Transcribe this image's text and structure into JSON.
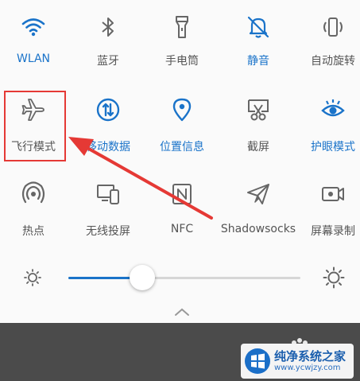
{
  "tiles_row1": [
    {
      "label": "WLAN",
      "icon": "wifi-icon",
      "active": true
    },
    {
      "label": "蓝牙",
      "icon": "bluetooth-icon",
      "active": false
    },
    {
      "label": "手电筒",
      "icon": "flashlight-icon",
      "active": false
    },
    {
      "label": "静音",
      "icon": "bell-off-icon",
      "active": true
    },
    {
      "label": "自动旋转",
      "icon": "rotate-icon",
      "active": false
    }
  ],
  "tiles_row2": [
    {
      "label": "飞行模式",
      "icon": "airplane-icon",
      "active": false
    },
    {
      "label": "移动数据",
      "icon": "mobile-data-icon",
      "active": true
    },
    {
      "label": "位置信息",
      "icon": "location-icon",
      "active": true
    },
    {
      "label": "截屏",
      "icon": "screenshot-icon",
      "active": false
    },
    {
      "label": "护眼模式",
      "icon": "eye-icon",
      "active": true
    }
  ],
  "tiles_row3": [
    {
      "label": "热点",
      "icon": "hotspot-icon",
      "active": false
    },
    {
      "label": "无线投屏",
      "icon": "cast-icon",
      "active": false
    },
    {
      "label": "NFC",
      "icon": "nfc-icon",
      "active": false
    },
    {
      "label": "Shadowsocks",
      "icon": "paper-plane-icon",
      "active": false
    },
    {
      "label": "屏幕录制",
      "icon": "screen-record-icon",
      "active": false
    }
  ],
  "brightness": {
    "level": 0.32
  },
  "colors": {
    "accent": "#1a73c9",
    "inactive": "#555555",
    "highlight": "#e53935"
  },
  "watermark": {
    "title": "纯净系统之家",
    "url": "www.ycwjzy.com"
  }
}
